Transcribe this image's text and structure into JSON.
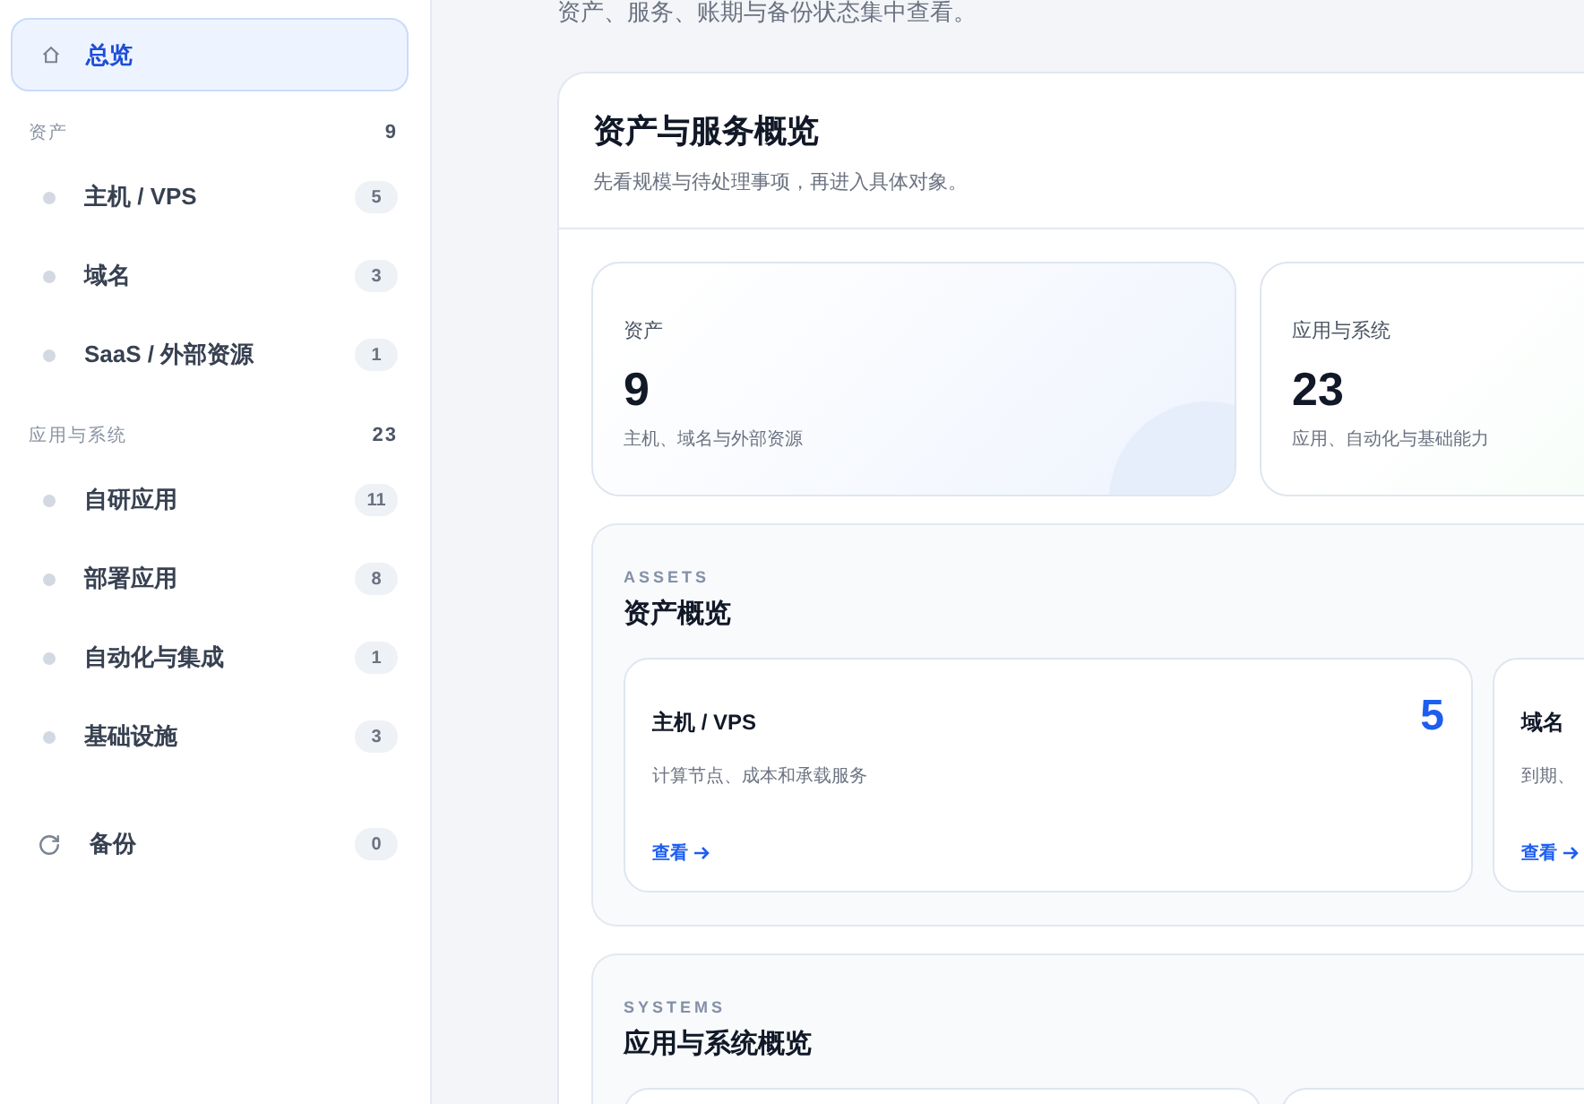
{
  "sidebar": {
    "home": {
      "label": "总览",
      "selected": true
    },
    "groups": [
      {
        "label": "资产",
        "count": "9",
        "items": [
          {
            "label": "主机 / VPS",
            "count": "5",
            "selected": false
          },
          {
            "label": "域名",
            "count": "3",
            "selected": false
          },
          {
            "label": "SaaS / 外部资源",
            "count": "1",
            "selected": false
          }
        ]
      },
      {
        "label": "应用与系统",
        "count": "23",
        "items": [
          {
            "label": "自研应用",
            "count": "11",
            "selected": false
          },
          {
            "label": "部署应用",
            "count": "8",
            "selected": false
          },
          {
            "label": "自动化与集成",
            "count": "1",
            "selected": false
          },
          {
            "label": "基础设施",
            "count": "3",
            "selected": false
          }
        ]
      }
    ],
    "backup": {
      "label": "备份",
      "count": "0",
      "selected": false
    }
  },
  "intro": "资产、服务、账期与备份状态集中查看。",
  "panel": {
    "title": "资产与服务概览",
    "subtitle": "先看规模与待处理事项，再进入具体对象。"
  },
  "stats": [
    {
      "kind": "blue",
      "label": "资产",
      "value": "9",
      "caption": "主机、域名与外部资源"
    },
    {
      "kind": "green",
      "label": "应用与系统",
      "value": "23",
      "caption": "应用、自动化与基础能力"
    }
  ],
  "sections": [
    {
      "eyebrow": "ASSETS",
      "title": "资产概览",
      "cards": [
        {
          "title": "主机 / VPS",
          "count": "5",
          "description": "计算节点、成本和承载服务",
          "link": "查看"
        },
        {
          "title": "域名",
          "description": "到期、",
          "link": "查看"
        }
      ]
    },
    {
      "eyebrow": "SYSTEMS",
      "title": "应用与系统概览"
    }
  ]
}
